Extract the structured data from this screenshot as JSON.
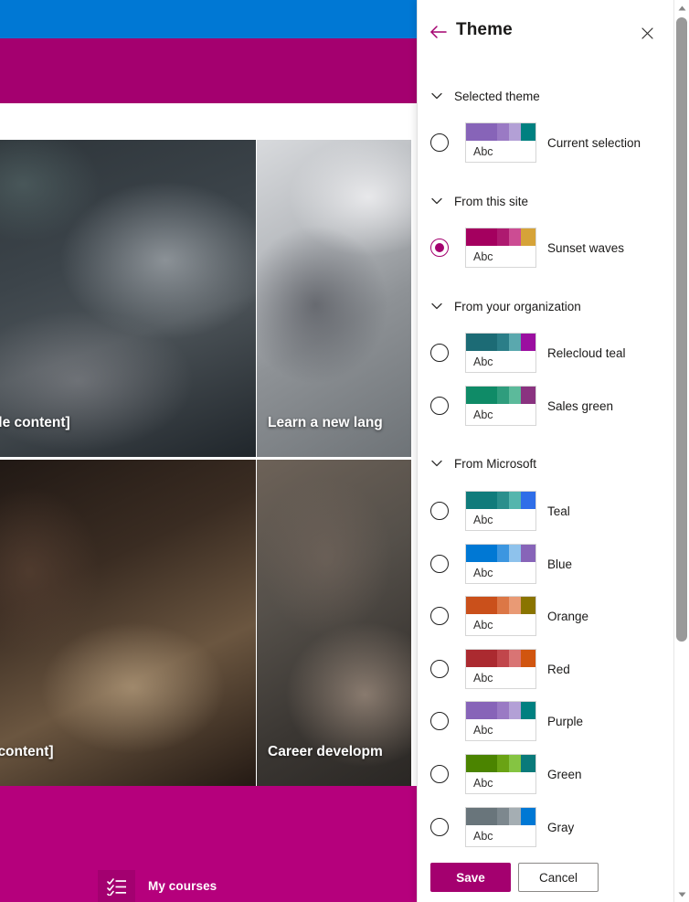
{
  "background": {
    "topbar_color": "#0078d4",
    "band_color": "#a4006f",
    "footer_color": "#b5007c",
    "tiles": [
      {
        "caption": "s [Sample content]"
      },
      {
        "caption": "Learn a new lang"
      },
      {
        "caption": "Sample content]"
      },
      {
        "caption": "Career developm"
      }
    ],
    "footer": {
      "icon": "checklist-icon",
      "label": "My courses"
    }
  },
  "panel": {
    "title": "Theme",
    "back_icon": "back-arrow-icon",
    "close_icon": "close-icon",
    "accent_color": "#a4006f",
    "sections": [
      {
        "id": "selected-theme",
        "label": "Selected theme",
        "chevron": "chevron-down-icon",
        "themes": [
          {
            "name": "Current selection",
            "selected": false,
            "sample_text": "Abc",
            "colors": [
              "#8764b8",
              "#9a7ac4",
              "#b3a0d6",
              "#008080"
            ]
          }
        ]
      },
      {
        "id": "from-this-site",
        "label": "From this site",
        "chevron": "chevron-down-icon",
        "themes": [
          {
            "name": "Sunset waves",
            "selected": true,
            "sample_text": "Abc",
            "colors": [
              "#a4005f",
              "#ae1a70",
              "#cc4c93",
              "#d6a338"
            ]
          }
        ]
      },
      {
        "id": "from-your-organization",
        "label": "From your organization",
        "chevron": "chevron-down-icon",
        "themes": [
          {
            "name": "Relecloud teal",
            "selected": false,
            "sample_text": "Abc",
            "colors": [
              "#1c6b75",
              "#2b7e88",
              "#5aa8ae",
              "#9b0fa0"
            ]
          },
          {
            "name": "Sales green",
            "selected": false,
            "sample_text": "Abc",
            "colors": [
              "#0f8b67",
              "#2f9d7d",
              "#5cba9b",
              "#8a3380"
            ]
          }
        ]
      },
      {
        "id": "from-microsoft",
        "label": "From Microsoft",
        "chevron": "chevron-down-icon",
        "themes": [
          {
            "name": "Teal",
            "selected": false,
            "sample_text": "Abc",
            "colors": [
              "#107b7b",
              "#2a8f8c",
              "#55b5ad",
              "#2f6ee8"
            ]
          },
          {
            "name": "Blue",
            "selected": false,
            "sample_text": "Abc",
            "colors": [
              "#0078d4",
              "#3c96e0",
              "#8ec2ec",
              "#8764b8"
            ]
          },
          {
            "name": "Orange",
            "selected": false,
            "sample_text": "Abc",
            "colors": [
              "#ca501b",
              "#dc7746",
              "#e99a75",
              "#8a7400"
            ]
          },
          {
            "name": "Red",
            "selected": false,
            "sample_text": "Abc",
            "colors": [
              "#ab2a30",
              "#c1464b",
              "#d97474",
              "#d1550f"
            ]
          },
          {
            "name": "Purple",
            "selected": false,
            "sample_text": "Abc",
            "colors": [
              "#8764b8",
              "#9a7ac4",
              "#b3a0d6",
              "#008080"
            ]
          },
          {
            "name": "Green",
            "selected": false,
            "sample_text": "Abc",
            "colors": [
              "#4b8400",
              "#6aa314",
              "#85c442",
              "#0a7a7a"
            ]
          },
          {
            "name": "Gray",
            "selected": false,
            "sample_text": "Abc",
            "colors": [
              "#69757b",
              "#7d888e",
              "#a5aeb3",
              "#0078d4"
            ]
          }
        ]
      }
    ],
    "buttons": {
      "save": "Save",
      "cancel": "Cancel"
    }
  },
  "scrollbar": {
    "up_icon": "scroll-up-arrow-icon",
    "down_icon": "scroll-down-arrow-icon",
    "thumb": "scrollbar-thumb"
  }
}
